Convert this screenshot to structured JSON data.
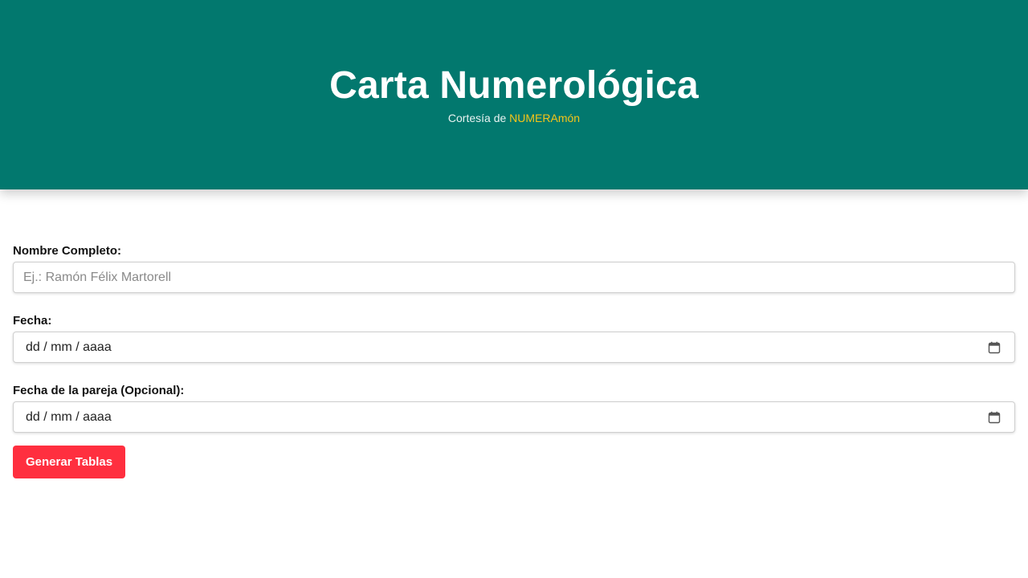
{
  "header": {
    "title": "Carta Numerológica",
    "subtitle_prefix": "Cortesía de ",
    "subtitle_brand": "NUMERAmón",
    "background_color": "#02786e",
    "brand_color": "#f5c518"
  },
  "form": {
    "name_label": "Nombre Completo:",
    "name_placeholder": "Ej.: Ramón Félix Martorell",
    "name_value": "",
    "date_label": "Fecha:",
    "date_value": "dd / mm / aaaa",
    "partner_date_label": "Fecha de la pareja (Opcional):",
    "partner_date_value": "dd / mm / aaaa",
    "date_icon": "calendar-icon",
    "submit_label": "Generar Tablas",
    "submit_color": "#ff2f3f"
  }
}
